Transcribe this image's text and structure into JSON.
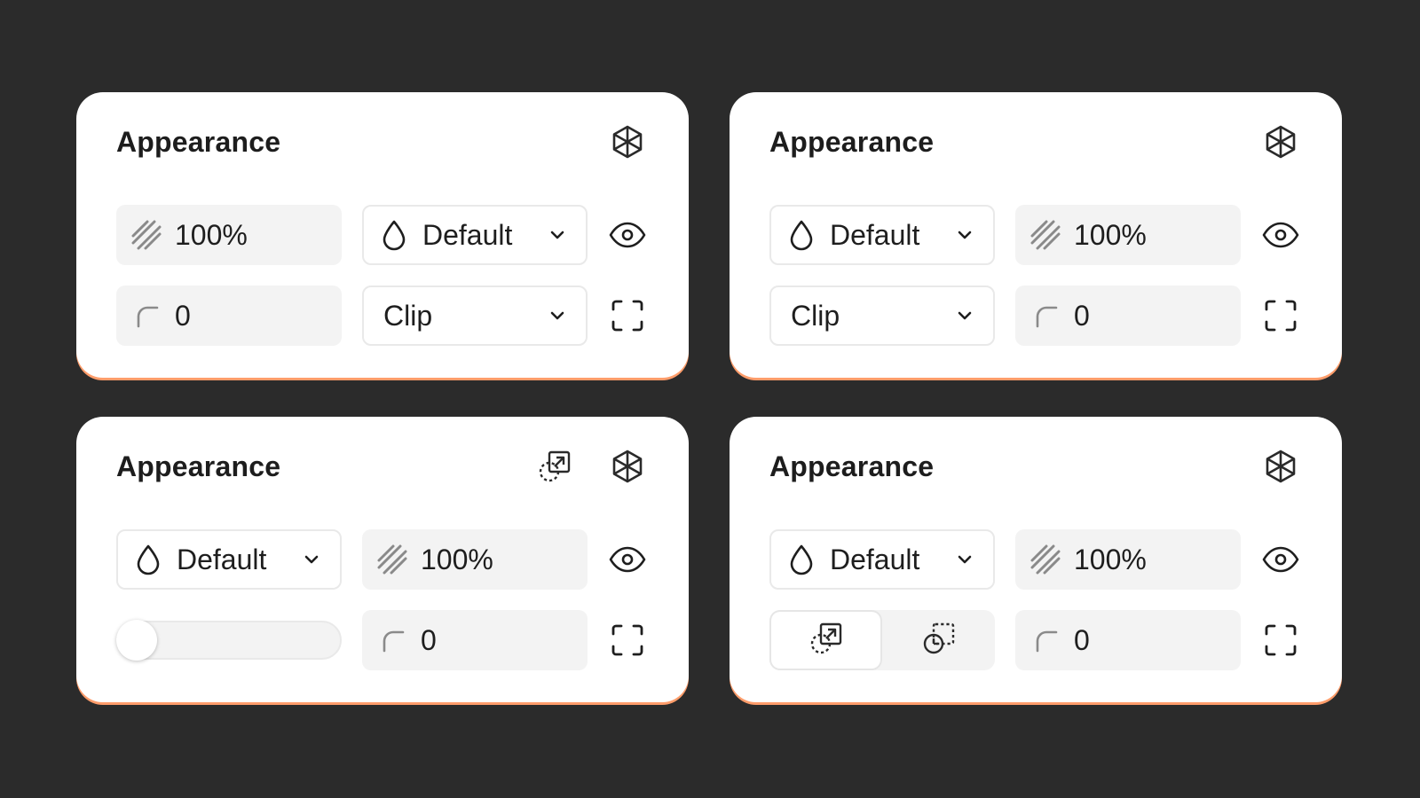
{
  "panels": [
    {
      "title": "Appearance",
      "opacity": "100%",
      "blend": "Default",
      "radius": "0",
      "overflow": "Clip"
    },
    {
      "title": "Appearance",
      "opacity": "100%",
      "blend": "Default",
      "radius": "0",
      "overflow": "Clip"
    },
    {
      "title": "Appearance",
      "opacity": "100%",
      "blend": "Default",
      "radius": "0",
      "slider_value": 0
    },
    {
      "title": "Appearance",
      "opacity": "100%",
      "blend": "Default",
      "radius": "0",
      "segment_selected": "clip-content"
    }
  ],
  "icons": {
    "header": "variables-icon",
    "visibility": "eye-icon",
    "corners": "fullscreen-corners-icon",
    "blend": "drop-icon",
    "opacity": "hatch-opacity-icon",
    "radius": "corner-radius-icon",
    "clip_content": "clip-content-icon",
    "clip_hidden": "clip-hidden-icon"
  },
  "colors": {
    "background": "#2b2b2b",
    "panel": "#ffffff",
    "field_fill": "#f3f3f3",
    "accent_edge": "#ff9d6b",
    "text": "#1e1e1e"
  }
}
